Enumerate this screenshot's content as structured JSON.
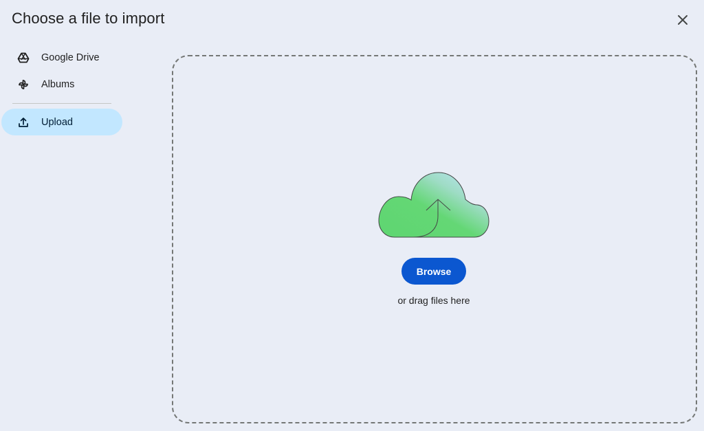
{
  "dialog": {
    "title": "Choose a file to import",
    "close_icon": "close-icon"
  },
  "sidebar": {
    "items": [
      {
        "label": "Google Drive",
        "icon": "google-drive-icon",
        "active": false
      },
      {
        "label": "Albums",
        "icon": "pinwheel-albums-icon",
        "active": false
      },
      {
        "label": "Upload",
        "icon": "upload-icon",
        "active": true
      }
    ]
  },
  "dropzone": {
    "illustration": "cloud-upload-icon",
    "browse_label": "Browse",
    "hint": "or drag files here"
  },
  "colors": {
    "background": "#e9edf6",
    "active_item": "#c2e7ff",
    "primary_button": "#0b57d0",
    "cloud_green": "#5ed671",
    "cloud_blue": "#c2e7ff"
  }
}
